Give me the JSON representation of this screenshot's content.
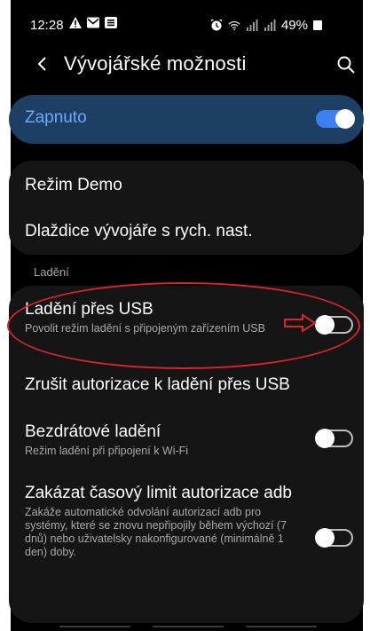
{
  "status_bar": {
    "time": "12:28",
    "battery": "49%",
    "left_icons": [
      "warning-icon",
      "mail-icon",
      "app-icon"
    ],
    "right_icons": [
      "alarm-icon",
      "wifi-icon",
      "signal-icon",
      "signal-icon-2",
      "battery-icon"
    ]
  },
  "header": {
    "title": "Vývojářské možnosti"
  },
  "master": {
    "label": "Zapnuto",
    "enabled": true
  },
  "general": {
    "items": [
      {
        "title": "Režim Demo"
      },
      {
        "title": "Dlaždice vývojáře s rych. nast."
      }
    ]
  },
  "debug_section": {
    "label": "Ladění",
    "items": [
      {
        "title": "Ladění přes USB",
        "subtitle": "Povolit režim ladění s připojeným zařízením USB",
        "enabled": false
      },
      {
        "title": "Zrušit autorizace k ladění přes USB"
      },
      {
        "title": "Bezdrátové ladění",
        "subtitle": "Režim ladění při připojení k Wi-Fi",
        "enabled": false
      },
      {
        "title": "Zakázat časový limit autorizace adb",
        "subtitle": "Zakáže automatické odvolání autorizací adb pro systémy, které se znovu nepřipojily během výchozí (7 dnů) nebo uživatelsky nakonfigurované (minimálně 1 den) doby.",
        "enabled": false
      }
    ]
  },
  "colors": {
    "accent": "#3e7ff0",
    "master_card": "#1d3f63",
    "master_text": "#6fa6ff",
    "card": "#151515",
    "annotation": "#d9242a"
  }
}
